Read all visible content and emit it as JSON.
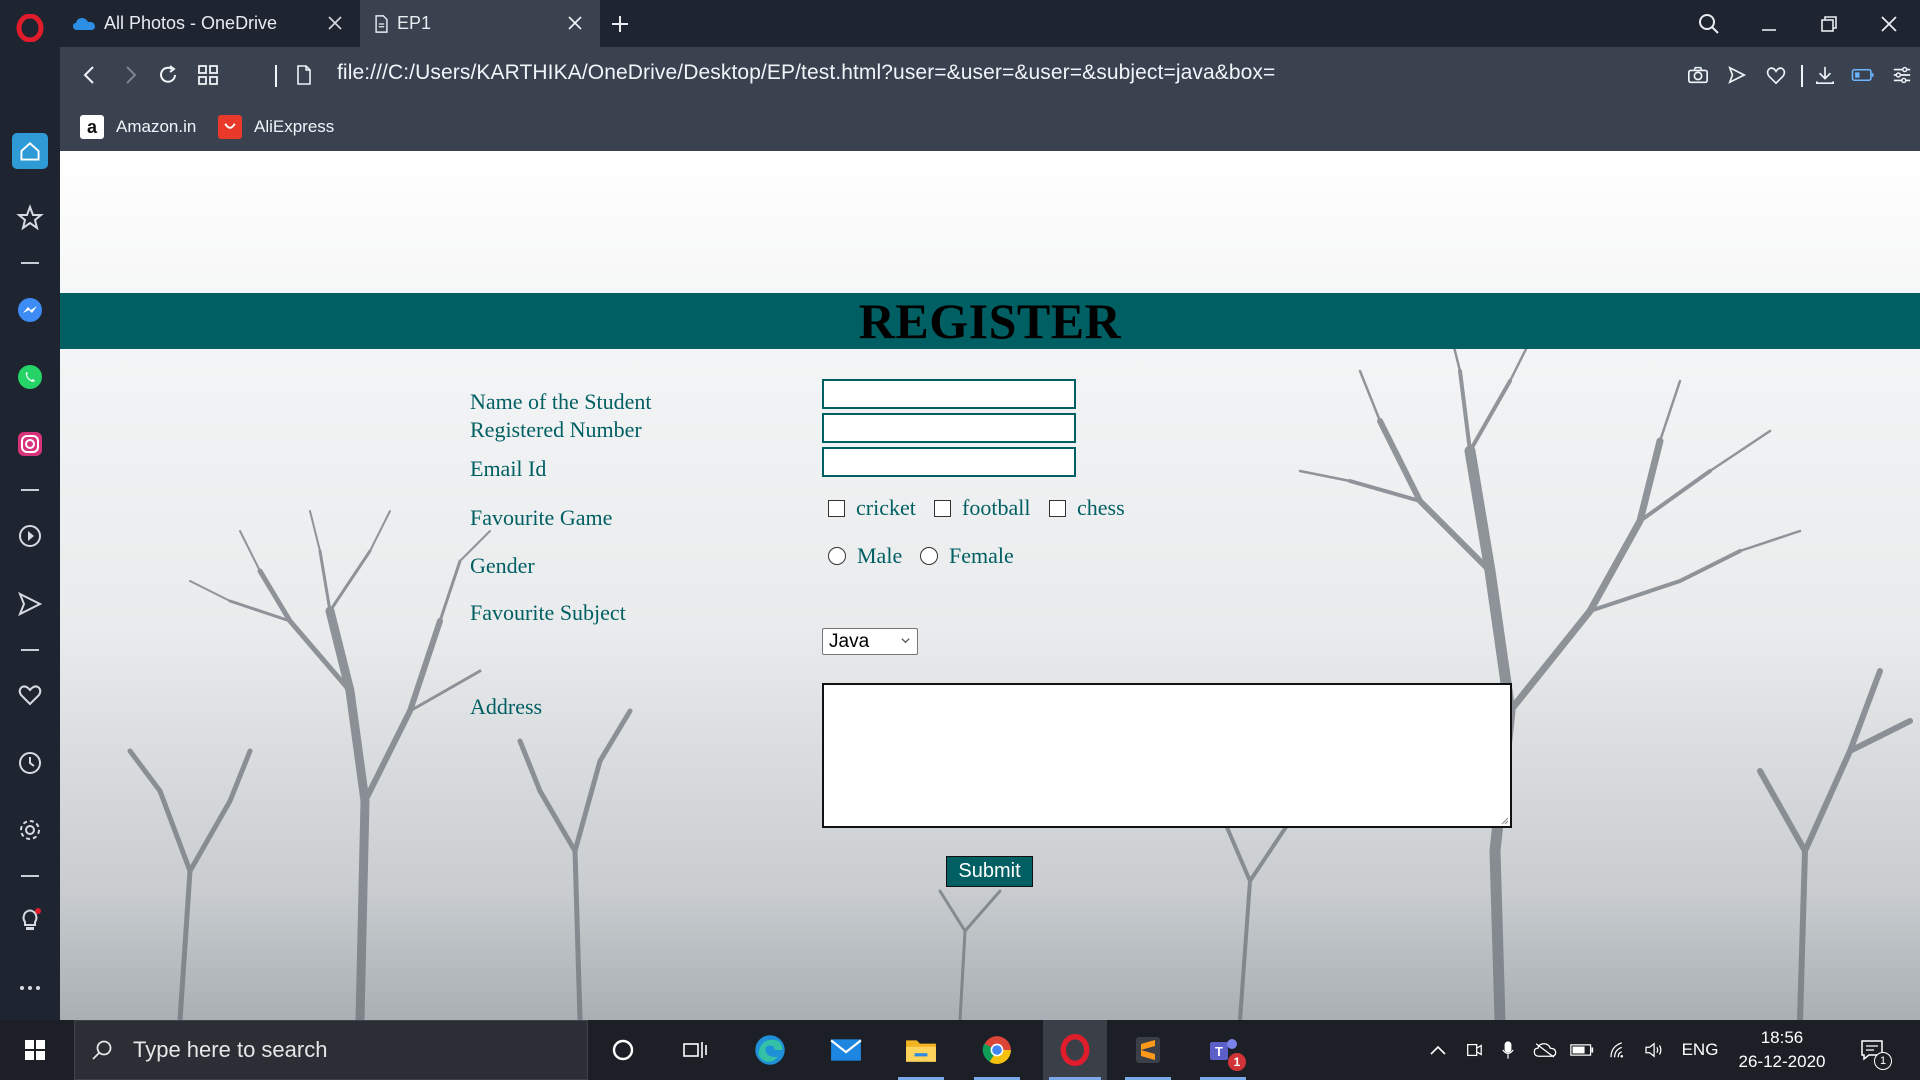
{
  "browser": {
    "tabs": [
      {
        "title": "All Photos - OneDrive",
        "icon": "onedrive-icon",
        "active": false
      },
      {
        "title": "EP1",
        "icon": "page-icon",
        "active": true
      }
    ],
    "url": "file:///C:/Users/KARTHIKA/OneDrive/Desktop/EP/test.html?user=&user=&user=&subject=java&box=",
    "bookmarks": [
      {
        "label": "Amazon.in",
        "icon": "amazon-icon"
      },
      {
        "label": "AliExpress",
        "icon": "aliexpress-icon"
      }
    ],
    "sidebar_icons": [
      "home-icon",
      "bookmark-star-icon",
      "messenger-icon",
      "whatsapp-icon",
      "instagram-icon",
      "player-icon",
      "flow-icon",
      "heart-icon",
      "history-icon",
      "settings-icon",
      "tips-icon",
      "more-icon"
    ]
  },
  "page": {
    "title": "REGISTER",
    "fields": {
      "name_label": "Name of the Student",
      "regno_label": "Registered Number",
      "email_label": "Email Id",
      "game_label": "Favourite Game",
      "gender_label": "Gender",
      "subject_label": "Favourite Subject",
      "address_label": "Address"
    },
    "games": [
      "cricket",
      "football",
      "chess"
    ],
    "genders": [
      "Male",
      "Female"
    ],
    "subject_selected": "Java",
    "submit_label": "Submit"
  },
  "taskbar": {
    "search_placeholder": "Type here to search",
    "apps": [
      "cortana-icon",
      "task-view-icon",
      "edge-icon",
      "mail-icon",
      "file-explorer-icon",
      "chrome-icon",
      "opera-icon",
      "sublime-icon",
      "teams-icon"
    ],
    "teams_badge": "1",
    "language": "ENG",
    "time": "18:56",
    "date": "26-12-2020",
    "notification_count": "1"
  },
  "colors": {
    "accent": "#005f63",
    "browser_dark": "#1e2430",
    "browser_mid": "#3a4250",
    "opera_red": "#e11d2c"
  }
}
